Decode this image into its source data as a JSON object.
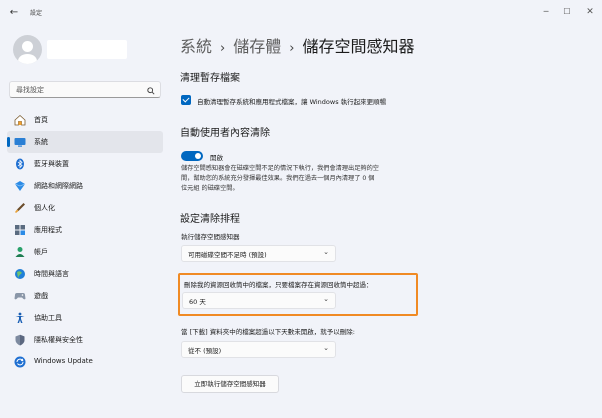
{
  "window": {
    "title": "設定",
    "back_glyph": "←",
    "min_glyph": "─",
    "max_glyph": "☐",
    "close_glyph": "✕"
  },
  "sidebar": {
    "search_placeholder": "尋找設定",
    "items": [
      {
        "label": "首頁",
        "icon": "home-icon",
        "selected": false
      },
      {
        "label": "系統",
        "icon": "system-icon",
        "selected": true
      },
      {
        "label": "藍牙與裝置",
        "icon": "bluetooth-icon",
        "selected": false
      },
      {
        "label": "網路和網際網路",
        "icon": "network-icon",
        "selected": false
      },
      {
        "label": "個人化",
        "icon": "personalization-icon",
        "selected": false
      },
      {
        "label": "應用程式",
        "icon": "apps-icon",
        "selected": false
      },
      {
        "label": "帳戶",
        "icon": "accounts-icon",
        "selected": false
      },
      {
        "label": "時間與語言",
        "icon": "time-language-icon",
        "selected": false
      },
      {
        "label": "遊戲",
        "icon": "gaming-icon",
        "selected": false
      },
      {
        "label": "協助工具",
        "icon": "accessibility-icon",
        "selected": false
      },
      {
        "label": "隱私權與安全性",
        "icon": "privacy-icon",
        "selected": false
      },
      {
        "label": "Windows Update",
        "icon": "windows-update-icon",
        "selected": false
      }
    ]
  },
  "breadcrumb": {
    "part1": "系統",
    "part2": "儲存體",
    "part3": "儲存空間感知器",
    "separator": "›"
  },
  "cleanup": {
    "heading": "清理暫存檔案",
    "checkbox_label": "自動清理暫存系統和應用程式檔案，讓 Windows 執行起來更順暢",
    "checked": true
  },
  "auto_clean": {
    "heading": "自動使用者內容清除",
    "toggle_label": "開啟",
    "toggle_on": true,
    "description_line1": "儲存空間感知器會在磁碟空間不足的情況下執行，我們會清理出足夠的空",
    "description_line2": "間，幫助您的系統充分發揮最佳效果。我們在過去一個月內清理了 0 個",
    "description_line3": "位元組 的磁碟空間。"
  },
  "schedule": {
    "heading": "設定清除排程",
    "run_label": "執行儲存空間感知器",
    "run_value": "可用磁碟空間不足時 (預設)",
    "recycle_label": "刪除我的資源回收筒中的檔案，只要檔案存在資源回收筒中超過：",
    "recycle_value": "60 天",
    "downloads_label": "當 [下載] 資料夾中的檔案超過以下天數未開啟，就予以刪除:",
    "downloads_value": "從不 (預設)",
    "run_now_button": "立即執行儲存空間感知器"
  },
  "colors": {
    "accent": "#0067c0",
    "highlight": "#f08a24"
  }
}
